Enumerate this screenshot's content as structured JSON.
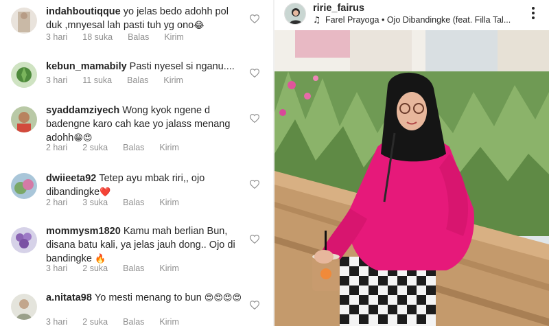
{
  "comments": [
    {
      "username": "indahboutiqque",
      "text": "yo jelas bedo adohh pol duk ,mnyesal lah pasti tuh yg ono",
      "emoji": "😂",
      "time": "3 hari",
      "likes": "18 suka",
      "reply": "Balas",
      "send": "Kirim"
    },
    {
      "username": "kebun_mamabily",
      "text": "Pasti nyesel si nganu....",
      "emoji": "",
      "time": "3 hari",
      "likes": "11 suka",
      "reply": "Balas",
      "send": "Kirim"
    },
    {
      "username": "syaddamziyech",
      "text": "Wong kyok ngene d badengne karo cah kae yo jalass menang adohh",
      "emoji": "😁😍",
      "time": "2 hari",
      "likes": "2 suka",
      "reply": "Balas",
      "send": "Kirim"
    },
    {
      "username": "dwiieeta92",
      "text": "Tetep ayu mbak riri,, ojo dibandingke",
      "emoji": "❤️",
      "time": "2 hari",
      "likes": "3 suka",
      "reply": "Balas",
      "send": "Kirim"
    },
    {
      "username": "mommysm1820",
      "text": "Kamu mah berlian Bun, disana batu kali, ya jelas jauh dong.. Ojo di bandingke",
      "emoji": "🔥",
      "time": "3 hari",
      "likes": "2 suka",
      "reply": "Balas",
      "send": "Kirim"
    },
    {
      "username": "a.nitata98",
      "text": "Yo mesti menang to bun",
      "emoji": "😍😍😍😍",
      "time": "3 hari",
      "likes": "2 suka",
      "reply": "Balas",
      "send": "Kirim"
    }
  ],
  "post": {
    "username": "ririe_fairus",
    "music": "Farel Prayoga • Ojo Dibandingke (feat. Filla Tal...",
    "music_icon": "music-note-icon",
    "more_icon": "more-vertical-icon"
  },
  "colors": {
    "text": "#262626",
    "meta": "#8e8e8e",
    "pink_top": "#e6197a"
  }
}
